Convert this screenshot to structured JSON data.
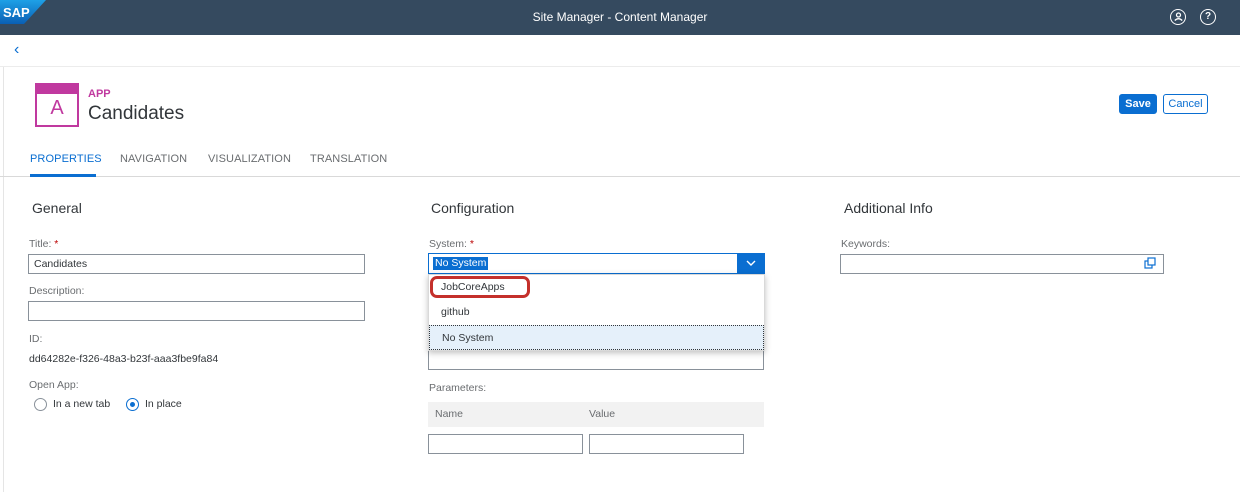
{
  "shell": {
    "logo": "SAP",
    "title": "Site Manager - Content Manager",
    "user_icon": "user-circle-icon",
    "help_icon": "help-circle-icon"
  },
  "subbar": {
    "back_glyph": "‹"
  },
  "header": {
    "tile_letter": "A",
    "kicker": "APP",
    "title": "Candidates",
    "save_label": "Save",
    "cancel_label": "Cancel",
    "accent": "#c0399f"
  },
  "tabs": [
    {
      "label": "PROPERTIES",
      "active": true
    },
    {
      "label": "NAVIGATION",
      "active": false
    },
    {
      "label": "VISUALIZATION",
      "active": false
    },
    {
      "label": "TRANSLATION",
      "active": false
    }
  ],
  "general": {
    "section_title": "General",
    "title_label": "Title:",
    "title_value": "Candidates",
    "description_label": "Description:",
    "description_value": "",
    "id_label": "ID:",
    "id_value": "dd64282e-f326-48a3-b23f-aaa3fbe9fa84",
    "open_app_label": "Open App:",
    "open_app_options": [
      {
        "label": "In a new tab",
        "checked": false
      },
      {
        "label": "In place",
        "checked": true
      }
    ]
  },
  "configuration": {
    "section_title": "Configuration",
    "system_label": "System:",
    "system_value": "No System",
    "system_options": [
      {
        "label": "JobCoreApps",
        "highlighted": true
      },
      {
        "label": "github",
        "highlighted": false
      },
      {
        "label": "No System",
        "selected": true
      }
    ],
    "parameters_label": "Parameters:",
    "param_columns": [
      "Name",
      "Value"
    ]
  },
  "additional": {
    "section_title": "Additional Info",
    "keywords_label": "Keywords:",
    "keywords_value": ""
  },
  "required_marker": "*",
  "colors": {
    "shell": "#354a5f",
    "brand_blue": "#0a6ed1",
    "highlight_red": "#c4302b"
  }
}
